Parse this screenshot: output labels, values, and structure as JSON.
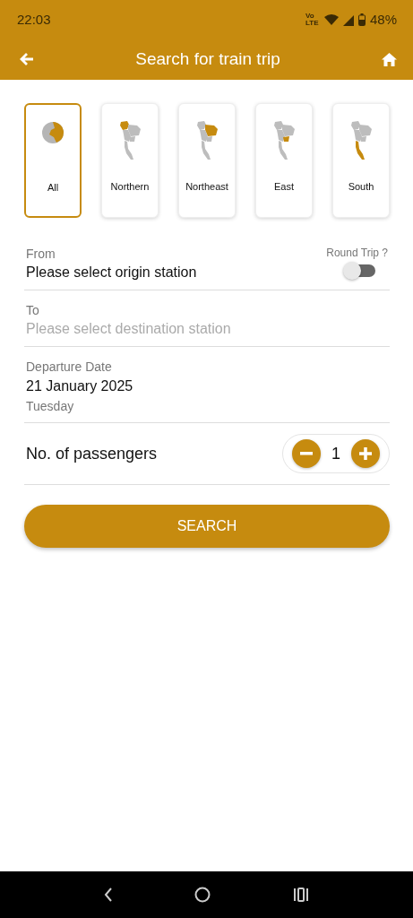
{
  "status_bar": {
    "time": "22:03",
    "network": "Vo LTE",
    "battery": "48%"
  },
  "header": {
    "title": "Search for train trip"
  },
  "regions": [
    {
      "kind": "all",
      "label": "All",
      "selected": true
    },
    {
      "kind": "northern",
      "label": "Northern",
      "selected": false
    },
    {
      "kind": "northeast",
      "label": "Northeast",
      "selected": false
    },
    {
      "kind": "east",
      "label": "East",
      "selected": false
    },
    {
      "kind": "south",
      "label": "South",
      "selected": false
    }
  ],
  "from": {
    "label": "From",
    "value": "Please select origin station"
  },
  "round_trip": {
    "label": "Round Trip ?",
    "on": false
  },
  "to": {
    "label": "To",
    "placeholder": "Please select destination station"
  },
  "departure": {
    "label": "Departure Date",
    "date": "21 January 2025",
    "weekday": "Tuesday"
  },
  "passengers": {
    "label": "No. of passengers",
    "count": "1"
  },
  "search_button": "SEARCH"
}
